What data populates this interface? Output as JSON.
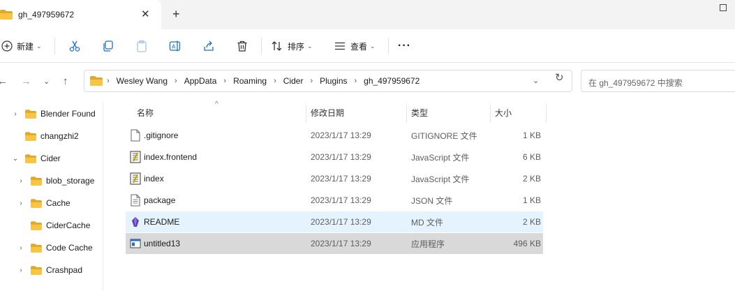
{
  "tab": {
    "title": "gh_497959672",
    "close": "✕",
    "new_tab": "+"
  },
  "toolbar": {
    "new_label": "新建",
    "sort_label": "排序",
    "view_label": "查看",
    "more": "···"
  },
  "address": {
    "crumbs": [
      "Wesley Wang",
      "AppData",
      "Roaming",
      "Cider",
      "Plugins",
      "gh_497959672"
    ],
    "separator": "›"
  },
  "search": {
    "placeholder": "在 gh_497959672 中搜索"
  },
  "sidebar": {
    "items": [
      {
        "label": "Blender Found",
        "arrow": "›",
        "level": 0
      },
      {
        "label": "changzhi2",
        "arrow": "",
        "level": 0
      },
      {
        "label": "Cider",
        "arrow": "⌄",
        "level": 0
      },
      {
        "label": "blob_storage",
        "arrow": "›",
        "level": 1
      },
      {
        "label": "Cache",
        "arrow": "›",
        "level": 1
      },
      {
        "label": "CiderCache",
        "arrow": "",
        "level": 1
      },
      {
        "label": "Code Cache",
        "arrow": "›",
        "level": 1
      },
      {
        "label": "Crashpad",
        "arrow": "›",
        "level": 1
      }
    ]
  },
  "columns": {
    "name": "名称",
    "date": "修改日期",
    "type": "类型",
    "size": "大小"
  },
  "files": [
    {
      "name": ".gitignore",
      "date": "2023/1/17 13:29",
      "type": "GITIGNORE 文件",
      "size": "1 KB",
      "icon": "blank-file-icon"
    },
    {
      "name": "index.frontend",
      "date": "2023/1/17 13:29",
      "type": "JavaScript 文件",
      "size": "6 KB",
      "icon": "js-script-icon"
    },
    {
      "name": "index",
      "date": "2023/1/17 13:29",
      "type": "JavaScript 文件",
      "size": "2 KB",
      "icon": "js-script-icon"
    },
    {
      "name": "package",
      "date": "2023/1/17 13:29",
      "type": "JSON 文件",
      "size": "1 KB",
      "icon": "text-file-icon"
    },
    {
      "name": "README",
      "date": "2023/1/17 13:29",
      "type": "MD 文件",
      "size": "2 KB",
      "icon": "markdown-file-icon"
    },
    {
      "name": "untitled13",
      "date": "2023/1/17 13:29",
      "type": "应用程序",
      "size": "496 KB",
      "icon": "application-icon"
    }
  ],
  "colors": {
    "folder": "#f7c443",
    "folder_dark": "#e0a82a",
    "hover_row": "#e5f3ff",
    "selected_row": "#d9d9d9"
  }
}
